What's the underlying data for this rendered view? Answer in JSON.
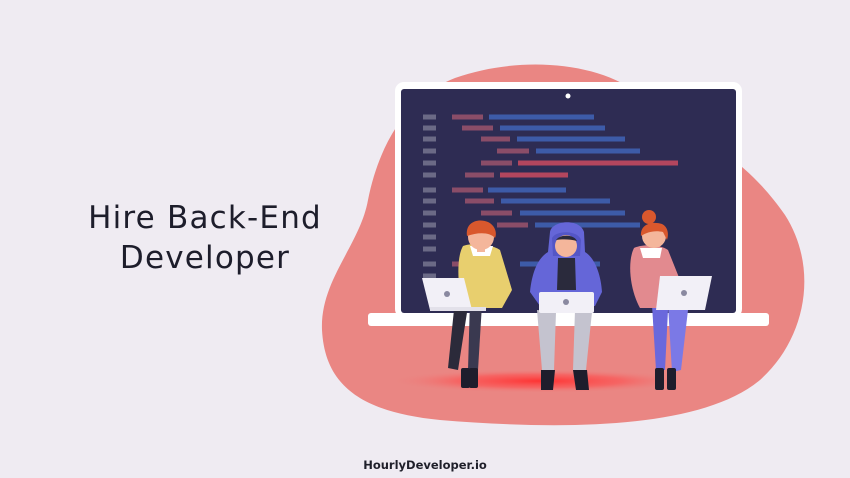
{
  "headline": {
    "line1": "Hire Back-End",
    "line2": "Developer"
  },
  "footer": {
    "brand": "HourlyDeveloper.io"
  },
  "colors": {
    "background": "#efebf2",
    "blob": "#ea8683",
    "screen": "#2e2c53",
    "frame": "#ffffff"
  },
  "illustration": {
    "subject": "three developers sitting on a laptop edge coding",
    "icons": [
      "laptop-icon",
      "developer-yellow-icon",
      "developer-hoodie-icon",
      "developer-pink-icon"
    ]
  }
}
